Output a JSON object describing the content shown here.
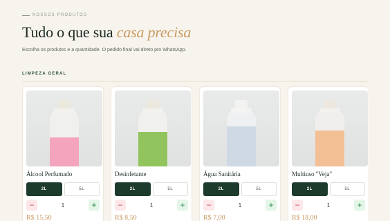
{
  "header": {
    "eyebrow": "NOSSOS PRODUTOS",
    "title_main": "Tudo o que sua ",
    "title_accent": "casa precisa",
    "description": "Escolha os produtos e a quantidade. O pedido final vai direto pro WhatsApp."
  },
  "section": {
    "label": "LIMPEZA GERAL"
  },
  "colors": {
    "accent": "#c99a62",
    "primary": "#1d3b2c",
    "background": "#f7f4ee"
  },
  "products": [
    {
      "name": "Álcool Perfumado",
      "sizes": [
        "2L",
        "5L"
      ],
      "selected_size": "2L",
      "quantity": "1",
      "price": "R$ 15,50",
      "liquid_color": "#f5a4bd"
    },
    {
      "name": "Desinfetante",
      "sizes": [
        "2L",
        "5L"
      ],
      "selected_size": "2L",
      "quantity": "1",
      "price": "R$ 8,50",
      "liquid_color": "#92c45e"
    },
    {
      "name": "Água Sanitária",
      "sizes": [
        "2L",
        "5L"
      ],
      "selected_size": "2L",
      "quantity": "1",
      "price": "R$ 7,00",
      "liquid_color": "#cfd9e3"
    },
    {
      "name": "Multiuso \"Veja\"",
      "sizes": [
        "2L",
        "5L"
      ],
      "selected_size": "2L",
      "quantity": "1",
      "price": "R$ 18,00",
      "liquid_color": "#f3bf95"
    }
  ],
  "icons": {
    "decrement": "minus-icon",
    "increment": "plus-icon"
  }
}
